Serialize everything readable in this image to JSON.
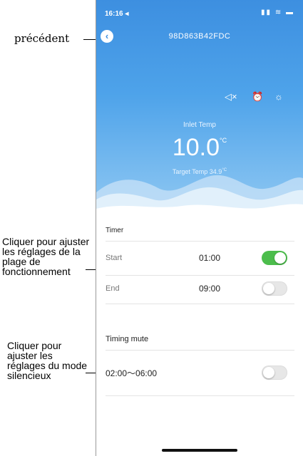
{
  "status": {
    "time": "16:16 ◂",
    "icons": "▮▮ ≋ ▬"
  },
  "header": {
    "device_id": "98D863B42FDC",
    "back_icon": "‹"
  },
  "hero": {
    "icons": {
      "mute": "◁×",
      "alarm": "⏰",
      "brightness": "☼"
    },
    "inlet_label": "Inlet Temp",
    "inlet_value": "10.0",
    "inlet_unit": "°C",
    "target_label": "Target Temp",
    "target_value": "34.9",
    "target_unit": "°C"
  },
  "timer": {
    "title": "Timer",
    "start_label": "Start",
    "start_time": "01:00",
    "start_enabled": true,
    "end_label": "End",
    "end_time": "09:00",
    "end_enabled": false
  },
  "timing_mute": {
    "title": "Timing mute",
    "range": "02:00～06:00",
    "enabled": false
  },
  "annotations": {
    "back": "précédent",
    "timer": "Cliquer pour ajuster les réglages de la plage de fonctionnement",
    "mute": "Cliquer pour ajuster les réglages du mode silencieux"
  },
  "colors": {
    "accent": "#3d8fe0",
    "toggle_on": "#4cbd4c",
    "toggle_off": "#e7e7e7"
  }
}
